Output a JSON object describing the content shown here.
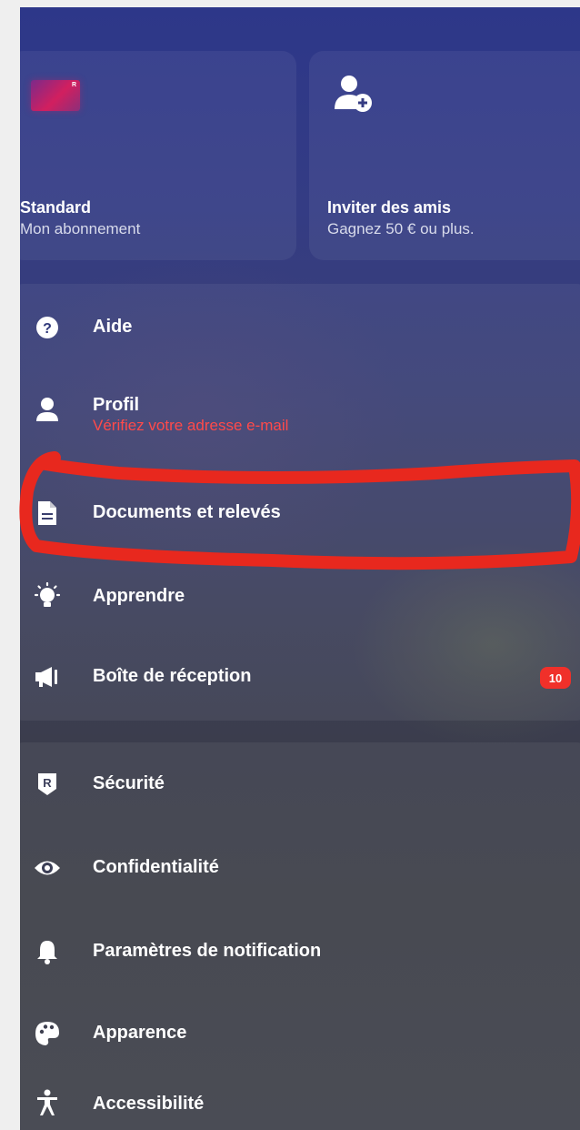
{
  "cards": [
    {
      "title": "Standard",
      "subtitle": "Mon abonnement",
      "logo_text": "R"
    },
    {
      "title": "Inviter des amis",
      "subtitle": "Gagnez 50 € ou plus."
    }
  ],
  "menu_main": [
    {
      "label": "Aide",
      "icon": "help-icon"
    },
    {
      "label": "Profil",
      "sub": "Vérifiez votre adresse e-mail",
      "icon": "user-icon"
    },
    {
      "label": "Documents et relevés",
      "icon": "document-icon"
    },
    {
      "label": "Apprendre",
      "icon": "lightbulb-icon"
    },
    {
      "label": "Boîte de réception",
      "icon": "megaphone-icon",
      "badge": "10"
    }
  ],
  "menu_settings": [
    {
      "label": "Sécurité",
      "icon": "shield-r-icon"
    },
    {
      "label": "Confidentialité",
      "icon": "eye-icon"
    },
    {
      "label": "Paramètres de notification",
      "icon": "bell-icon"
    },
    {
      "label": "Apparence",
      "icon": "palette-icon"
    },
    {
      "label": "Accessibilité",
      "icon": "accessibility-icon"
    }
  ],
  "colors": {
    "accent_warning": "#ff4a4a",
    "badge": "#f0302a",
    "annotation": "#e8281e"
  }
}
